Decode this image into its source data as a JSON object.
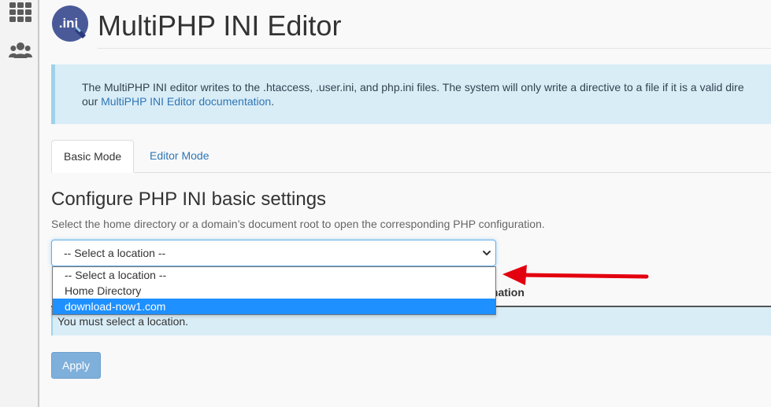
{
  "sidebar": {
    "icons": [
      {
        "name": "grid-icon"
      },
      {
        "name": "users-icon"
      }
    ]
  },
  "header": {
    "logo_text": ".ini",
    "title": "MultiPHP INI Editor"
  },
  "callout": {
    "line1": "The MultiPHP INI editor writes to the .htaccess, .user.ini, and php.ini files. The system will only write a directive to a file if it is a valid dire",
    "line2_prefix": "our ",
    "link_text": "MultiPHP INI Editor documentation",
    "line2_suffix": "."
  },
  "tabs": [
    {
      "label": "Basic Mode",
      "active": true
    },
    {
      "label": "Editor Mode",
      "active": false
    }
  ],
  "section": {
    "heading": "Configure PHP INI basic settings",
    "description": "Select the home directory or a domain’s document root to open the corresponding PHP configuration."
  },
  "location_select": {
    "value": "-- Select a location --",
    "options": [
      {
        "label": "-- Select a location --",
        "highlighted": false
      },
      {
        "label": "Home Directory",
        "highlighted": false
      },
      {
        "label": "download-now1.com",
        "highlighted": true
      }
    ]
  },
  "table": {
    "info_header_visible": "mation",
    "message": "You must select a location."
  },
  "apply_label": "Apply",
  "colors": {
    "accent": "#2e76b6",
    "info_bg": "#d9edf7",
    "highlight": "#1e90ff",
    "annotation_arrow": "#e3000f"
  }
}
